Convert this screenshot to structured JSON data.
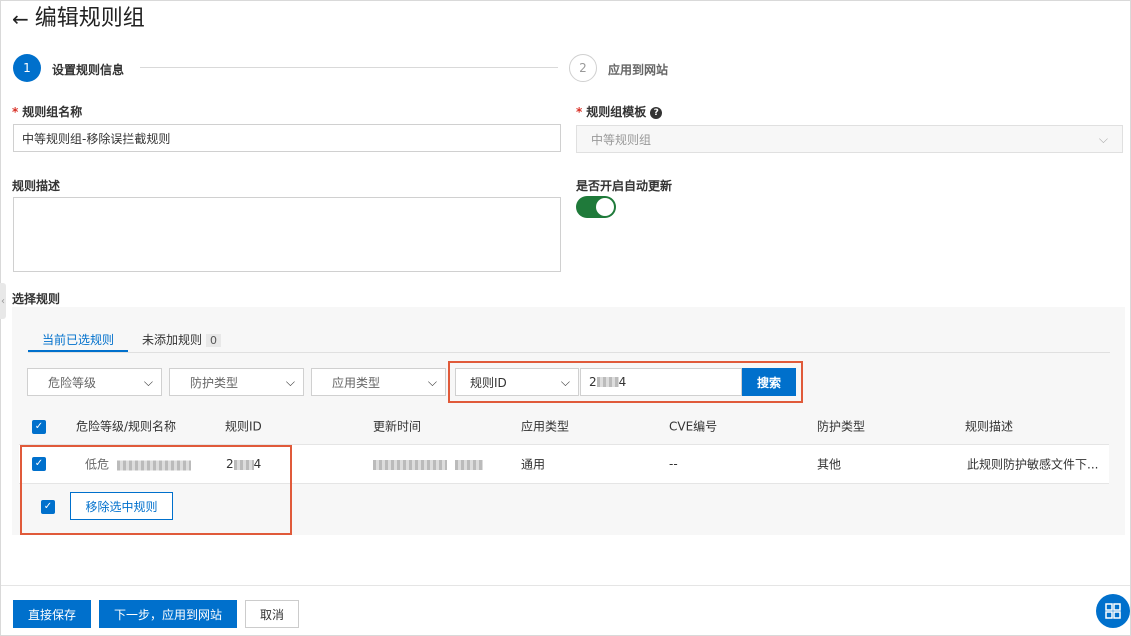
{
  "header": {
    "title": "编辑规则组"
  },
  "steps": [
    {
      "number": "1",
      "label": "设置规则信息"
    },
    {
      "number": "2",
      "label": "应用到网站"
    }
  ],
  "form": {
    "name_label": "规则组名称",
    "name_value": "中等规则组-移除误拦截规则",
    "template_label": "规则组模板",
    "template_value": "中等规则组",
    "desc_label": "规则描述",
    "auto_update_label": "是否开启自动更新",
    "auto_update_on": true
  },
  "rules": {
    "section_label": "选择规则",
    "tabs": [
      {
        "label": "当前已选规则"
      },
      {
        "label": "未添加规则",
        "count": "0"
      }
    ],
    "filters": {
      "risk_level": "危险等级",
      "protect_type": "防护类型",
      "app_type": "应用类型",
      "search_field": "规则ID",
      "search_value": "2",
      "search_value_suffix": "4",
      "search_button": "搜索"
    },
    "columns": [
      "危险等级/规则名称",
      "规则ID",
      "更新时间",
      "应用类型",
      "CVE编号",
      "防护类型",
      "规则描述"
    ],
    "rows": [
      {
        "risk": "低危",
        "rule_id_prefix": "2",
        "rule_id_suffix": "4",
        "app_type": "通用",
        "cve": "--",
        "protect_type": "其他",
        "description": "此规则防护敏感文件下..."
      }
    ],
    "remove_button": "移除选中规则"
  },
  "footer": {
    "save": "直接保存",
    "next": "下一步，应用到网站",
    "cancel": "取消"
  },
  "colors": {
    "primary": "#0070cc",
    "toggle": "#1f7a3a",
    "highlight": "#e05a3a"
  }
}
